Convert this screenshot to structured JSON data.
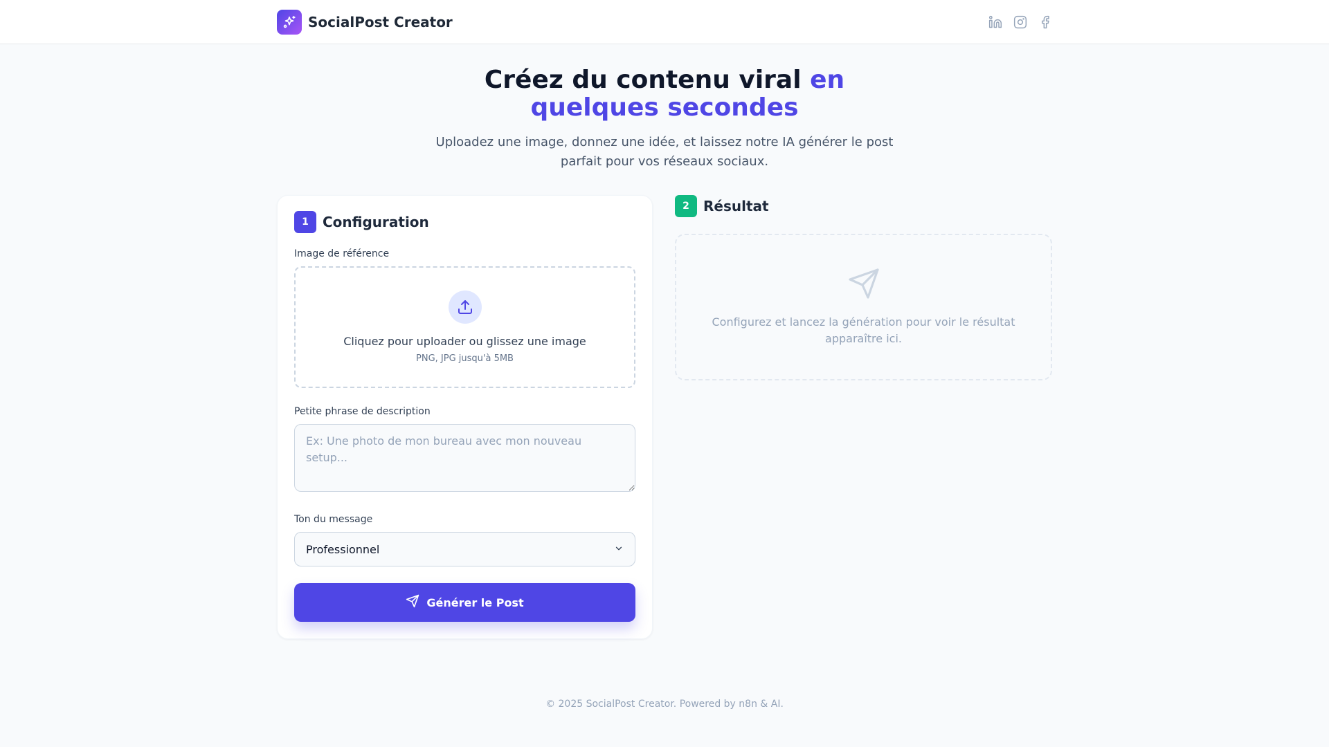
{
  "header": {
    "brand": "SocialPost Creator",
    "logo_icon": "sparkles-icon",
    "socials": [
      "linkedin-icon",
      "instagram-icon",
      "facebook-icon"
    ]
  },
  "hero": {
    "title_main": "Créez du contenu viral",
    "title_accent": "en quelques secondes",
    "subtitle": "Uploadez une image, donnez une idée, et laissez notre IA générer le post parfait pour vos réseaux sociaux."
  },
  "config": {
    "step": "1",
    "title": "Configuration",
    "image_label": "Image de référence",
    "upload_text": "Cliquez pour uploader ou glissez une image",
    "upload_hint": "PNG, JPG jusqu'à 5MB",
    "description_label": "Petite phrase de description",
    "description_placeholder": "Ex: Une photo de mon bureau avec mon nouveau setup...",
    "description_value": "",
    "tone_label": "Ton du message",
    "tone_value": "Professionnel",
    "generate_label": "Générer le Post"
  },
  "result": {
    "step": "2",
    "title": "Résultat",
    "empty_text": "Configurez et lancez la génération pour voir le résultat apparaître ici."
  },
  "footer": {
    "text": "© 2025 SocialPost Creator. Powered by n8n & AI."
  },
  "colors": {
    "primary": "#4f46e5",
    "success": "#10b981",
    "background": "#f8fafc"
  }
}
